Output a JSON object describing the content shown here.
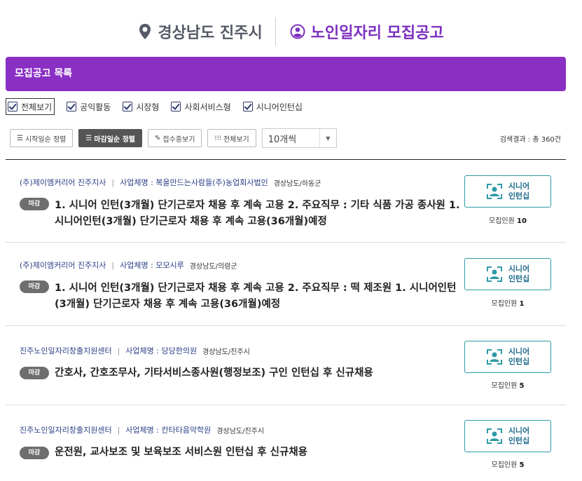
{
  "header": {
    "location": "경상남도 진주시",
    "title": "노인일자리 모집공고"
  },
  "section_title": "모집공고 목록",
  "filters": [
    {
      "label": "전체보기",
      "checked": true
    },
    {
      "label": "공익활동",
      "checked": true
    },
    {
      "label": "시장형",
      "checked": true
    },
    {
      "label": "사회서비스형",
      "checked": true
    },
    {
      "label": "시니어인턴십",
      "checked": true
    }
  ],
  "toolbar": {
    "sort_start": "시작일순 정렬",
    "sort_deadline": "마감일순 정렬",
    "accepting": "접수중보기",
    "all": "전체보기",
    "page_size": "10개씩"
  },
  "result_count": "검색결과 : 총 360건",
  "listings": [
    {
      "company": "(주)제이엠커리어 진주지사",
      "business_label": "사업체명 : 복을만드는사람들(주)농업회사법인",
      "region": "경상남도/하동군",
      "status": "마감",
      "title": "1. 시니어 인턴(3개월) 단기근로자 채용 후 계속 고용 2. 주요직무 : 기타 식품 가공 종사원 1. 시니어인턴(3개월) 단기근로자 채용 후 계속 고용(36개월)예정",
      "type_line1": "시니어",
      "type_line2": "인턴십",
      "recruit_label": "모집인원",
      "recruit_count": "10"
    },
    {
      "company": "(주)제이엠커리어 진주지사",
      "business_label": "사업체명 : 모모시루",
      "region": "경상남도/의령군",
      "status": "마감",
      "title": "1. 시니어 인턴(3개월) 단기근로자 채용 후 계속 고용 2. 주요직무 : 떡 제조원 1. 시니어인턴(3개월) 단기근로자 채용 후 계속 고용(36개월)예정",
      "type_line1": "시니어",
      "type_line2": "인턴십",
      "recruit_label": "모집인원",
      "recruit_count": "1"
    },
    {
      "company": "진주노인일자리창출지원센터",
      "business_label": "사업체명 : 당당한의원",
      "region": "경상남도/진주시",
      "status": "마감",
      "title": "간호사, 간호조무사, 기타서비스종사원(행정보조) 구인 인턴십 후 신규채용",
      "type_line1": "시니어",
      "type_line2": "인턴십",
      "recruit_label": "모집인원",
      "recruit_count": "5"
    },
    {
      "company": "진주노인일자리창출지원센터",
      "business_label": "사업체명 : 칸타타음악학원",
      "region": "경상남도/진주시",
      "status": "마감",
      "title": "운전원, 교사보조 및 보육보조 서비스원 인턴십 후 신규채용",
      "type_line1": "시니어",
      "type_line2": "인턴십",
      "recruit_label": "모집인원",
      "recruit_count": "5"
    }
  ]
}
